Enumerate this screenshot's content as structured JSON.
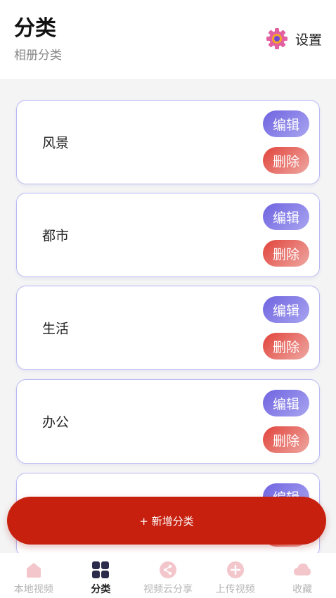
{
  "header": {
    "title": "分类",
    "subtitle": "相册分类",
    "settings_label": "设置"
  },
  "categories": [
    {
      "name": "风景",
      "edit_label": "编辑",
      "delete_label": "删除"
    },
    {
      "name": "都市",
      "edit_label": "编辑",
      "delete_label": "删除"
    },
    {
      "name": "生活",
      "edit_label": "编辑",
      "delete_label": "删除"
    },
    {
      "name": "办公",
      "edit_label": "编辑",
      "delete_label": "删除"
    },
    {
      "name": "",
      "edit_label": "编辑",
      "delete_label": "删除"
    }
  ],
  "add_button": {
    "label": "+ 新增分类"
  },
  "tabbar": {
    "items": [
      {
        "label": "本地视频",
        "icon": "home-icon",
        "active": false
      },
      {
        "label": "分类",
        "icon": "grid-icon",
        "active": true
      },
      {
        "label": "视频云分享",
        "icon": "share-icon",
        "active": false
      },
      {
        "label": "上传视频",
        "icon": "upload-icon",
        "active": false
      },
      {
        "label": "收藏",
        "icon": "cloud-icon",
        "active": false
      }
    ]
  },
  "colors": {
    "accent_red": "#c7200f",
    "edit_gradient": "#6f63e0",
    "delete_gradient": "#e1443b",
    "card_border": "#b9b8f3",
    "inactive_icon": "#f3c6cb",
    "active_icon": "#2b2b4b"
  }
}
